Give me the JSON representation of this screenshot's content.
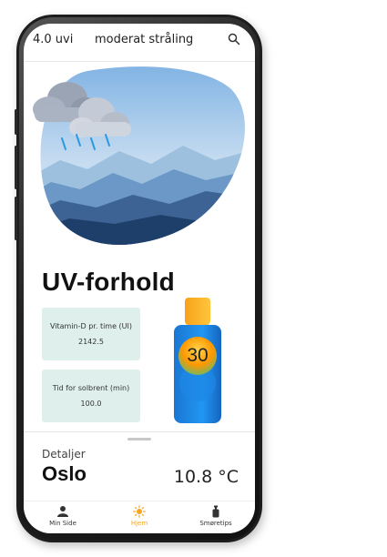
{
  "header": {
    "uvi_label": "4.0 uvi",
    "status_label": "moderat stråling"
  },
  "main": {
    "title": "UV-forhold",
    "cards": [
      {
        "label": "Vitamin-D pr. time (UI)",
        "value": "2142.5"
      },
      {
        "label": "Tid for solbrent (min)",
        "value": "100.0"
      }
    ],
    "spf_badge": "30"
  },
  "details": {
    "label": "Detaljer",
    "city": "Oslo",
    "temperature": "10.8 °C"
  },
  "nav": {
    "items": [
      {
        "label": "Min Side",
        "icon": "person-icon"
      },
      {
        "label": "Hjem",
        "icon": "sun-icon",
        "active": true
      },
      {
        "label": "Smøretips",
        "icon": "lotion-icon"
      }
    ]
  },
  "colors": {
    "accent": "#f5a623",
    "card_bg": "#dff0ec",
    "bottle_blue": "#1e88e5"
  }
}
